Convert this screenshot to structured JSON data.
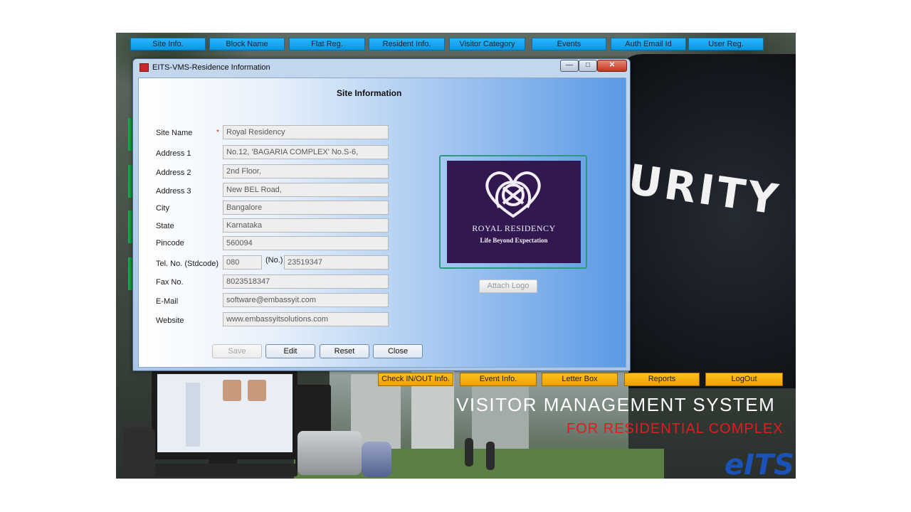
{
  "top_nav": [
    "Site Info.",
    "Block Name",
    "Flat Reg.",
    "Resident Info.",
    "Visitor Category",
    "Events",
    "Auth Email Id",
    "User Reg."
  ],
  "bottom_nav": [
    "Check IN/OUT Info.",
    "Event Info.",
    "Letter Box",
    "Reports",
    "LogOut"
  ],
  "background": {
    "security_text": "URITY",
    "title": "VISITOR MANAGEMENT SYSTEM",
    "subtitle": "FOR RESIDENTIAL COMPLEX",
    "logo_text": "eITS"
  },
  "dialog": {
    "title": "EITS-VMS-Residence Information",
    "section_title": "Site Information",
    "required_mark": "*",
    "fields": [
      {
        "label": "Site Name",
        "value": "Royal Residency"
      },
      {
        "label": "Address 1",
        "value": "No.12, 'BAGARIA COMPLEX' No.S-6,"
      },
      {
        "label": "Address 2",
        "value": "2nd Floor,"
      },
      {
        "label": "Address 3",
        "value": "New BEL Road,"
      },
      {
        "label": "City",
        "value": "Bangalore"
      },
      {
        "label": "State",
        "value": "Karnataka"
      },
      {
        "label": "Pincode",
        "value": "560094"
      },
      {
        "label": "Tel. No.  (Stdcode)",
        "stdcode": "080",
        "no_label": "(No.)",
        "value": "23519347"
      },
      {
        "label": "Fax No.",
        "value": "8023518347"
      },
      {
        "label": "E-Mail",
        "value": "software@embassyit.com"
      },
      {
        "label": "Website",
        "value": "www.embassyitsolutions.com"
      }
    ],
    "logo": {
      "name": "ROYAL RESIDENCY",
      "tagline": "Life Beyond Expectation",
      "attach_label": "Attach Logo"
    },
    "buttons": {
      "save": "Save",
      "edit": "Edit",
      "reset": "Reset",
      "close": "Close"
    }
  },
  "colors": {
    "top_nav": "#0797e2",
    "bottom_nav": "#f0a000",
    "logo_bg": "#311850",
    "subtitle": "#e21c1c"
  }
}
